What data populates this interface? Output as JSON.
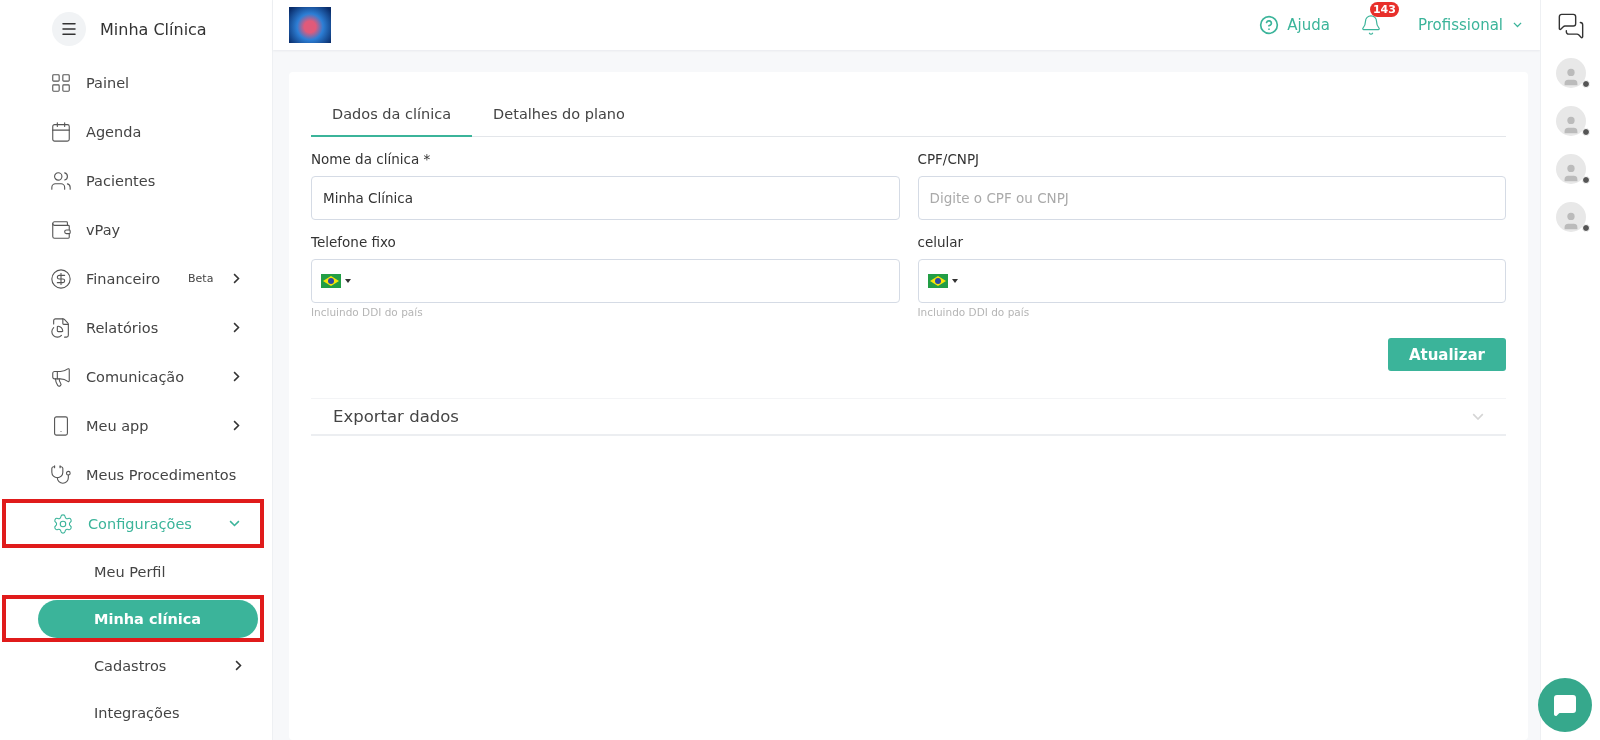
{
  "sidebar": {
    "title": "Minha Clínica",
    "items": [
      {
        "label": "Painel",
        "submenu": false
      },
      {
        "label": "Agenda",
        "submenu": false
      },
      {
        "label": "Pacientes",
        "submenu": false
      },
      {
        "label": "vPay",
        "submenu": false
      },
      {
        "label": "Financeiro",
        "badge": "Beta",
        "submenu": true
      },
      {
        "label": "Relatórios",
        "submenu": true
      },
      {
        "label": "Comunicação",
        "submenu": true
      },
      {
        "label": "Meu app",
        "submenu": true
      },
      {
        "label": "Meus Procedimentos",
        "submenu": false
      },
      {
        "label": "Configurações",
        "submenu": true,
        "expanded": true,
        "highlighted": true,
        "children": [
          {
            "label": "Meu Perfil",
            "selected": false,
            "submenu": false,
            "highlighted": false
          },
          {
            "label": "Minha clínica",
            "selected": true,
            "submenu": false,
            "highlighted": true
          },
          {
            "label": "Cadastros",
            "selected": false,
            "submenu": true,
            "highlighted": false
          },
          {
            "label": "Integrações",
            "selected": false,
            "submenu": false,
            "highlighted": false
          }
        ]
      }
    ]
  },
  "header": {
    "help": "Ajuda",
    "notifications": "143",
    "user": "Profissional"
  },
  "tabs": [
    {
      "label": "Dados da clínica",
      "selected": true
    },
    {
      "label": "Detalhes do plano",
      "selected": false
    }
  ],
  "fields": [
    {
      "kind": "text",
      "label": "Nome da clínica *",
      "value": "Minha Clínica"
    },
    {
      "kind": "text",
      "label": "CPF/CNPJ",
      "placeholder": "Digite o CPF ou CNPJ"
    },
    {
      "kind": "phone",
      "label": "Telefone fixo",
      "hint": "Incluindo DDI do país"
    },
    {
      "kind": "phone",
      "label": "celular",
      "hint": "Incluindo DDI do país"
    }
  ],
  "submit": "Atualizar",
  "export": {
    "title": "Exportar dados",
    "expanded": false
  },
  "contacts": [
    {
      "online": false
    },
    {
      "online": false
    },
    {
      "online": false
    },
    {
      "online": false
    }
  ]
}
